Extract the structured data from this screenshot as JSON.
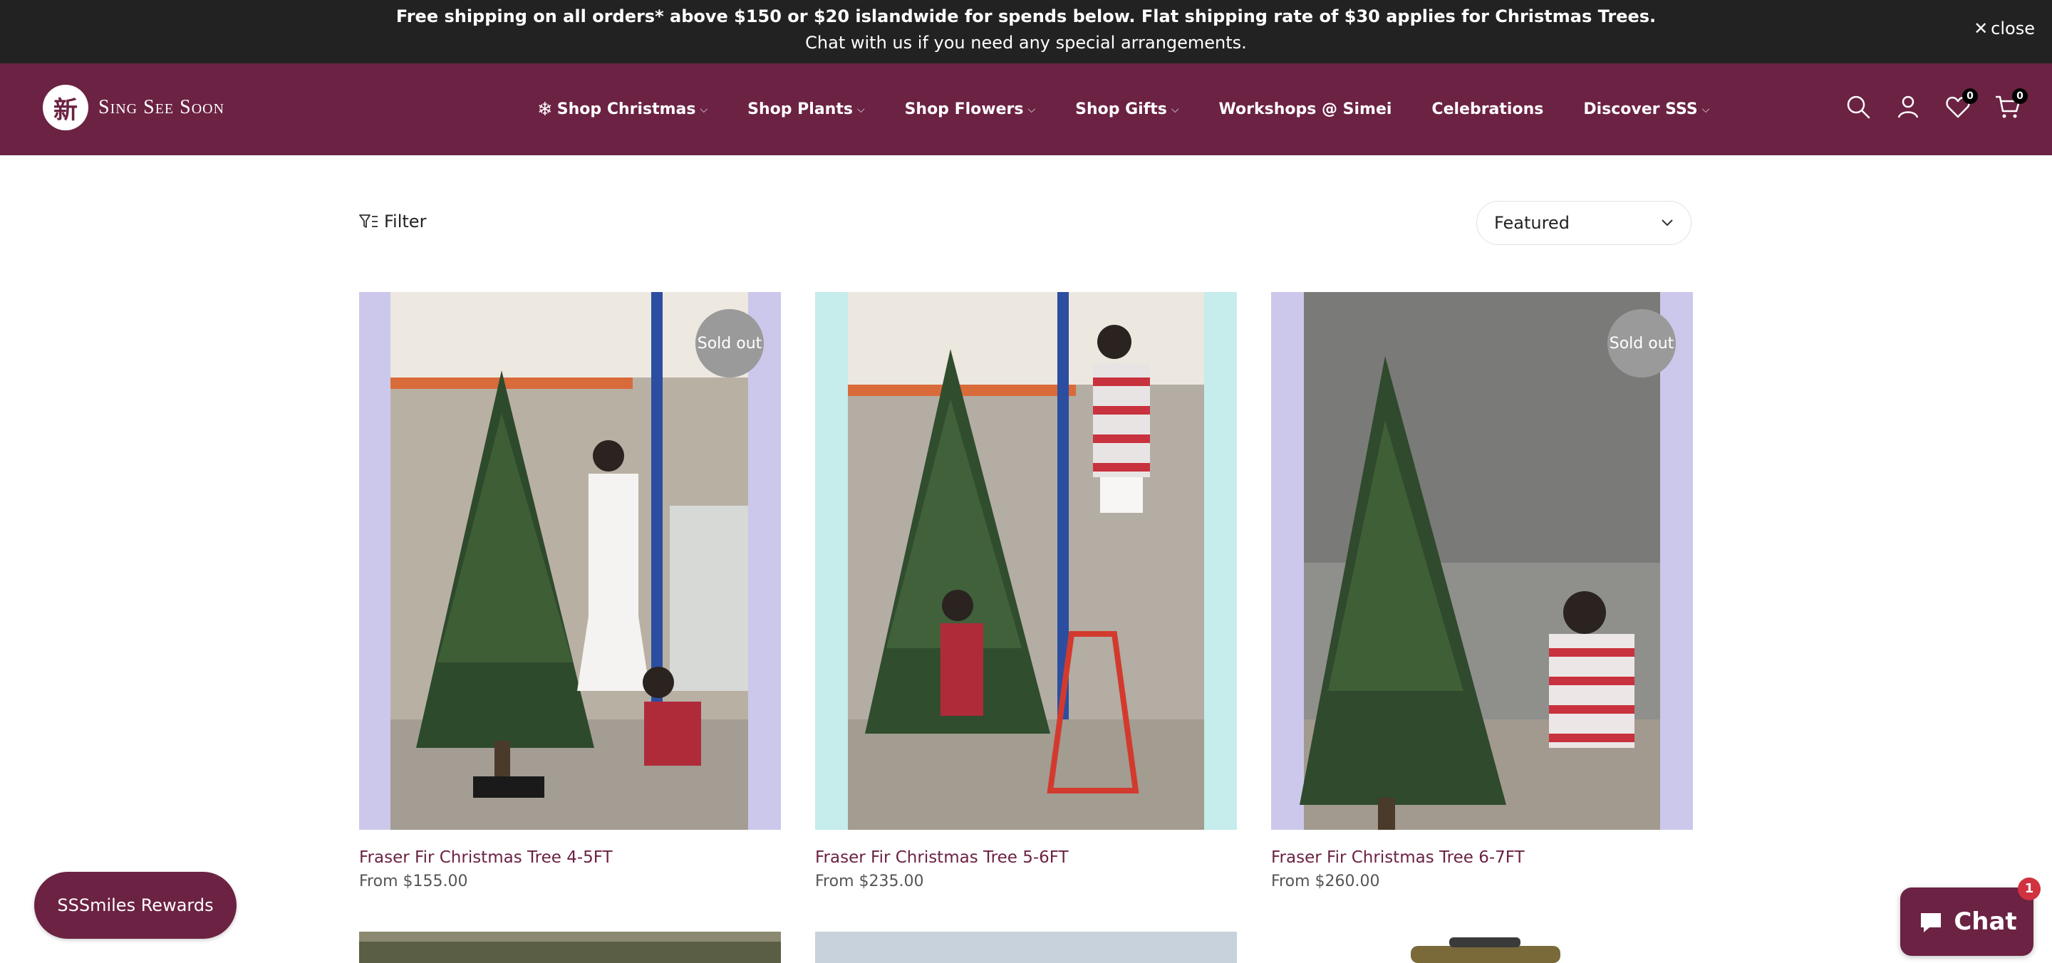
{
  "announcement": {
    "line1": "Free shipping on all orders* above $150 or $20 islandwide for spends below. Flat shipping rate of $30 applies for Christmas Trees.",
    "line2": "Chat with us if you need any special arrangements.",
    "close_label": "close"
  },
  "header": {
    "logo_text": "Sing See Soon",
    "logo_glyph": "新",
    "nav": [
      {
        "label": "Shop Christmas",
        "dropdown": true
      },
      {
        "label": "Shop Plants",
        "dropdown": true
      },
      {
        "label": "Shop Flowers",
        "dropdown": true
      },
      {
        "label": "Shop Gifts",
        "dropdown": true
      },
      {
        "label": "Workshops @ Simei",
        "dropdown": false
      },
      {
        "label": "Celebrations",
        "dropdown": false
      },
      {
        "label": "Discover SSS",
        "dropdown": true
      }
    ],
    "wishlist_count": "0",
    "cart_count": "0"
  },
  "toolbar": {
    "filter_label": "Filter",
    "sort_selected": "Featured"
  },
  "products": [
    {
      "title": "Fraser Fir Christmas Tree 4-5FT",
      "price": "From $155.00",
      "badge": "Sold out"
    },
    {
      "title": "Fraser Fir Christmas Tree 5-6FT",
      "price": "From $235.00",
      "badge": ""
    },
    {
      "title": "Fraser Fir Christmas Tree 6-7FT",
      "price": "From $260.00",
      "badge": "Sold out"
    }
  ],
  "floating": {
    "rewards_label": "SSSmiles Rewards",
    "chat_label": "Chat",
    "chat_unread": "1"
  },
  "colors": {
    "brand": "#6b2243",
    "announcement_bg": "#222222",
    "soldout_badge": "#9a9a9a"
  }
}
